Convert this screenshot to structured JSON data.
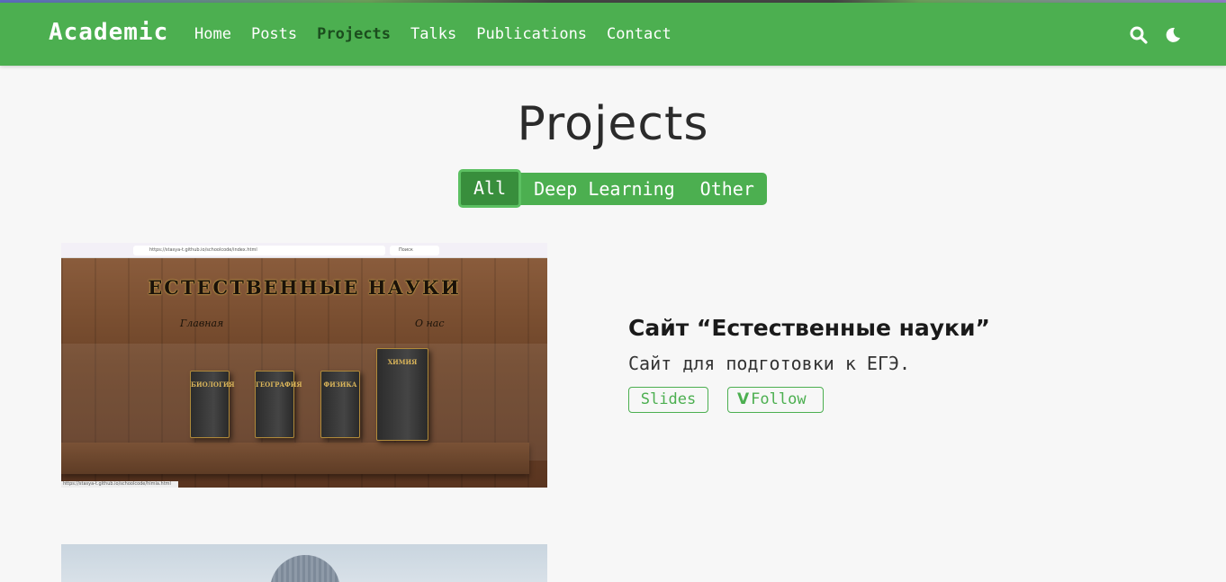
{
  "navbar": {
    "brand": "Academic",
    "links": [
      "Home",
      "Posts",
      "Projects",
      "Talks",
      "Publications",
      "Contact"
    ],
    "active": "Projects",
    "icons": [
      "search-icon",
      "moon-icon"
    ],
    "accent_color": "#4caf50"
  },
  "page": {
    "title": "Projects",
    "filters": [
      "All",
      "Deep Learning",
      "Other"
    ],
    "selected_filter": "All"
  },
  "projects": [
    {
      "title": "Сайт “Естественные науки”",
      "summary": "Сайт для подготовки к ЕГЭ.",
      "buttons": [
        "Slides",
        "Follow"
      ],
      "follow_icon": "V",
      "screenshot": {
        "url": "https://stasya-t.github.io/schoolcode/index.html",
        "search_placeholder": "Поиск",
        "heading": "ЕСТЕСТВЕННЫЕ НАУКИ",
        "nav_left": "Главная",
        "nav_right": "О нас",
        "books": [
          "БИОЛОГИЯ",
          "ГЕОГРАФИЯ",
          "ФИЗИКА",
          "ХИМИЯ"
        ],
        "status_url": "https://stasya-t.github.io/schoolcode/himia.html"
      }
    }
  ]
}
